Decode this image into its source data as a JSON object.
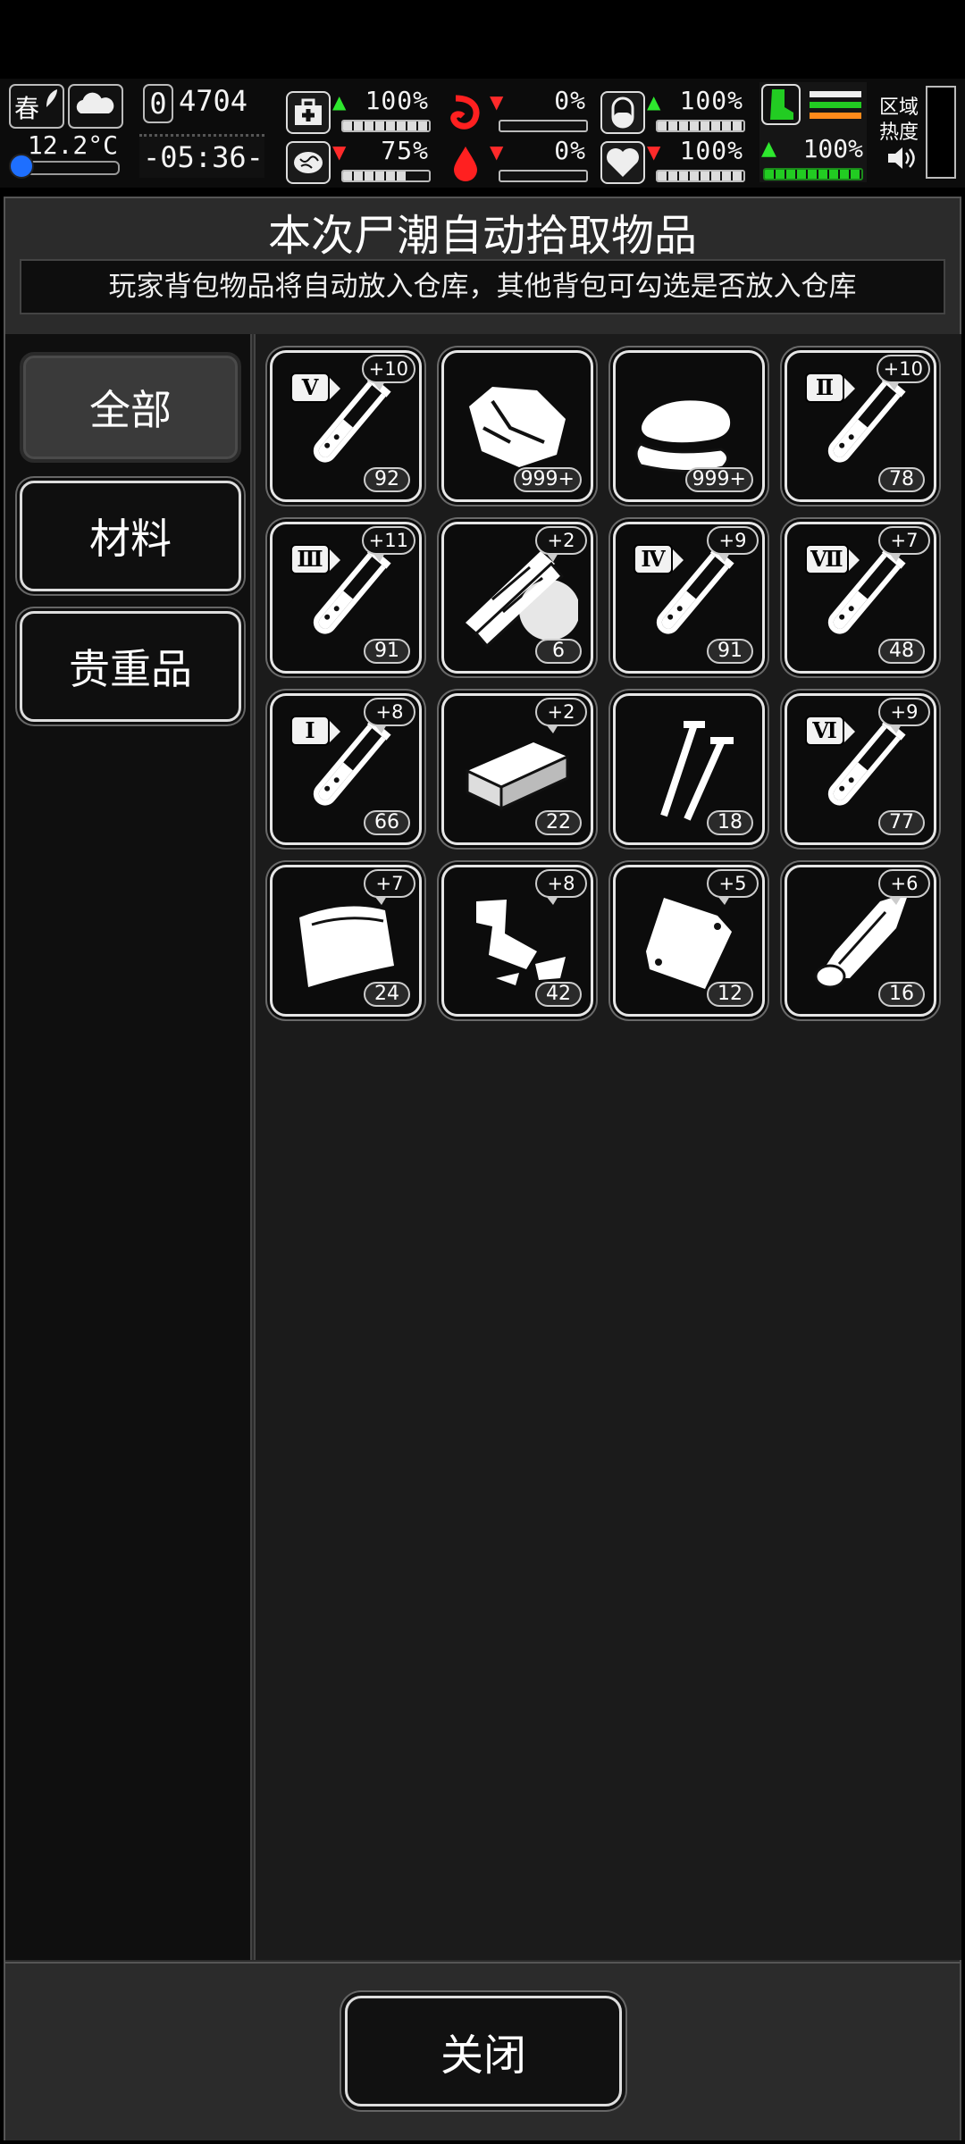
{
  "hud": {
    "season": "春",
    "temperature": "12.2°C",
    "day_digit": "0",
    "day_counter": "4704",
    "clock": "-05:36-",
    "zone_heat_label_1": "区域",
    "zone_heat_label_2": "热度",
    "stats": [
      {
        "name": "health",
        "icon": "medkit-icon",
        "trend": "up",
        "value": "100%",
        "level": 1.0
      },
      {
        "name": "hunger",
        "icon": "stomach-icon",
        "trend": "down",
        "value": "0%",
        "level": 0.0
      },
      {
        "name": "pills",
        "icon": "pill-icon",
        "trend": "up",
        "value": "100%",
        "level": 1.0
      },
      {
        "name": "mind",
        "icon": "brain-icon",
        "trend": "down",
        "value": "75%",
        "level": 0.75
      },
      {
        "name": "blood",
        "icon": "blood-drop-icon",
        "trend": "down",
        "value": "0%",
        "level": 0.0
      },
      {
        "name": "heart",
        "icon": "heart-icon",
        "trend": "down",
        "value": "100%",
        "level": 1.0
      }
    ],
    "stamina": {
      "trend": "up",
      "value": "100%",
      "level": 1.0
    },
    "colors": {
      "up": "#2ee82e",
      "down": "#ff2a2a",
      "stamina": "#22cc22"
    }
  },
  "panel": {
    "title": "本次尸潮自动拾取物品",
    "notice": "玩家背包物品将自动放入仓库，其他背包可勾选是否放入仓库"
  },
  "categories": [
    {
      "label": "全部",
      "selected": true
    },
    {
      "label": "材料",
      "selected": false
    },
    {
      "label": "贵重品",
      "selected": false
    }
  ],
  "items": [
    {
      "icon": "test-tube-icon",
      "tier": "Ⅴ",
      "bonus": "+10",
      "count": "92"
    },
    {
      "icon": "meat-chunk-icon",
      "tier": "",
      "bonus": "",
      "count": "999+"
    },
    {
      "icon": "cloth-rags-icon",
      "tier": "",
      "bonus": "",
      "count": "999+"
    },
    {
      "icon": "test-tube-icon",
      "tier": "Ⅱ",
      "bonus": "+10",
      "count": "78"
    },
    {
      "icon": "test-tube-icon",
      "tier": "Ⅲ",
      "bonus": "+11",
      "count": "91"
    },
    {
      "icon": "wood-planks-icon",
      "tier": "",
      "bonus": "+2",
      "count": "6"
    },
    {
      "icon": "test-tube-icon",
      "tier": "Ⅳ",
      "bonus": "+9",
      "count": "91"
    },
    {
      "icon": "test-tube-icon",
      "tier": "Ⅶ",
      "bonus": "+7",
      "count": "48"
    },
    {
      "icon": "test-tube-icon",
      "tier": "Ⅰ",
      "bonus": "+8",
      "count": "66"
    },
    {
      "icon": "brick-icon",
      "tier": "",
      "bonus": "+2",
      "count": "22"
    },
    {
      "icon": "nails-icon",
      "tier": "",
      "bonus": "",
      "count": "18"
    },
    {
      "icon": "test-tube-icon",
      "tier": "Ⅵ",
      "bonus": "+9",
      "count": "77"
    },
    {
      "icon": "fabric-sheet-icon",
      "tier": "",
      "bonus": "+7",
      "count": "24"
    },
    {
      "icon": "scrap-metal-icon",
      "tier": "",
      "bonus": "+8",
      "count": "42"
    },
    {
      "icon": "plastic-bag-icon",
      "tier": "",
      "bonus": "+5",
      "count": "12"
    },
    {
      "icon": "leather-roll-icon",
      "tier": "",
      "bonus": "+6",
      "count": "16"
    }
  ],
  "footer": {
    "close_label": "关闭"
  }
}
